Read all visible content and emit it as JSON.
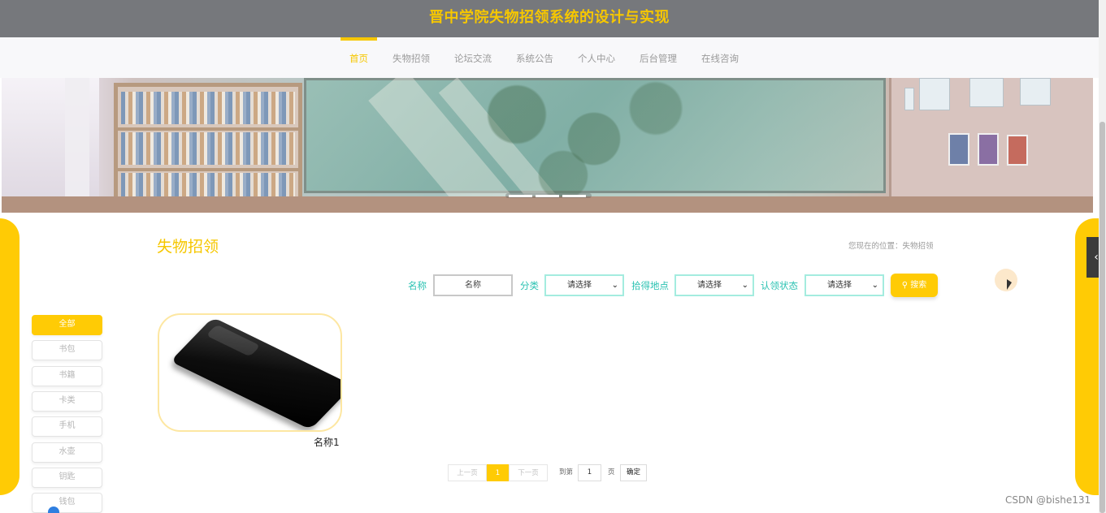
{
  "header": {
    "title": "晋中学院失物招领系统的设计与实现"
  },
  "nav": {
    "items": [
      {
        "label": "首页",
        "active": true
      },
      {
        "label": "失物招领"
      },
      {
        "label": "论坛交流"
      },
      {
        "label": "系统公告"
      },
      {
        "label": "个人中心"
      },
      {
        "label": "后台管理"
      },
      {
        "label": "在线咨询"
      }
    ]
  },
  "page": {
    "heading": "失物招领",
    "breadcrumb": "您现在的位置：失物招领"
  },
  "search": {
    "name_label": "名称",
    "name_placeholder": "名称",
    "category_label": "分类",
    "category_value": "请选择",
    "location_label": "拾得地点",
    "location_value": "请选择",
    "status_label": "认领状态",
    "status_value": "请选择",
    "search_button": "搜索"
  },
  "categories": [
    "全部",
    "书包",
    "书籍",
    "卡类",
    "手机",
    "水壶",
    "钥匙",
    "钱包"
  ],
  "items": [
    {
      "name": "名称1"
    }
  ],
  "pagination": {
    "prev": "上一页",
    "current": "1",
    "next": "下一页",
    "goto_prefix": "到第",
    "goto_value": "1",
    "goto_suffix": "页",
    "confirm": "确定"
  },
  "watermark": "CSDN @bishe131",
  "colors": {
    "accent": "#ffcb05",
    "teal_label": "#2bc2b2",
    "header_bg": "#76787c"
  },
  "icons": {
    "side_tab": "chevron-left-icon",
    "search": "magnifier-icon"
  }
}
